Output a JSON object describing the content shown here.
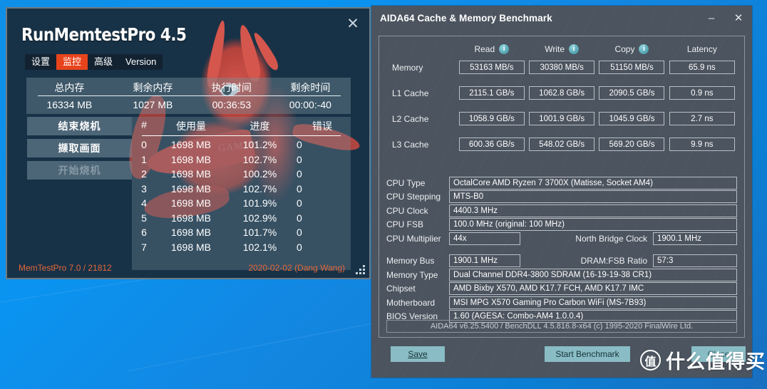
{
  "desktop": {
    "wallpaper_color": "#0a8fe8"
  },
  "memtest_window": {
    "title": "RunMemtestPro 4.5",
    "close_label": "✕",
    "tabs": [
      {
        "label": "设置",
        "active": false
      },
      {
        "label": "监控",
        "active": true
      },
      {
        "label": "高级",
        "active": false
      },
      {
        "label": "Version",
        "active": false
      }
    ],
    "active_tab_color": "#e8441c",
    "stats": {
      "headers": [
        "总内存",
        "剩余内存",
        "执行时间",
        "剩余时间"
      ],
      "values": [
        "16334 MB",
        "1027 MB",
        "00:36:53",
        "00:00:-40"
      ]
    },
    "buttons": [
      {
        "label": "结束烧机",
        "disabled": false
      },
      {
        "label": "撷取画面",
        "disabled": false
      },
      {
        "label": "开始烧机",
        "disabled": true
      }
    ],
    "table": {
      "headers": [
        "#",
        "使用量",
        "进度",
        "错误"
      ],
      "rows": [
        {
          "index": "0",
          "usage": "1698 MB",
          "progress": "101.2%",
          "errors": "0"
        },
        {
          "index": "1",
          "usage": "1698 MB",
          "progress": "102.7%",
          "errors": "0"
        },
        {
          "index": "2",
          "usage": "1698 MB",
          "progress": "100.2%",
          "errors": "0"
        },
        {
          "index": "3",
          "usage": "1698 MB",
          "progress": "102.7%",
          "errors": "0"
        },
        {
          "index": "4",
          "usage": "1698 MB",
          "progress": "101.9%",
          "errors": "0"
        },
        {
          "index": "5",
          "usage": "1698 MB",
          "progress": "102.9%",
          "errors": "0"
        },
        {
          "index": "6",
          "usage": "1698 MB",
          "progress": "101.7%",
          "errors": "0"
        },
        {
          "index": "7",
          "usage": "1698 MB",
          "progress": "102.1%",
          "errors": "0"
        }
      ]
    },
    "footer_left": "MemTestPro 7.0 / 21812",
    "footer_right": "2020-02-02 (Dang Wang)",
    "footer_color": "#e4663a",
    "background_watermark": "GAMING"
  },
  "aida_window": {
    "title": "AIDA64 Cache & Memory Benchmark",
    "minimize_label": "–",
    "close_label": "✕",
    "benchmark": {
      "columns": [
        "Read",
        "Write",
        "Copy",
        "Latency"
      ],
      "column_has_info_icon": [
        true,
        true,
        true,
        false
      ],
      "rows": [
        {
          "label": "Memory",
          "read": "53163 MB/s",
          "write": "30380 MB/s",
          "copy": "51150 MB/s",
          "latency": "65.9 ns"
        },
        {
          "label": "L1 Cache",
          "read": "2115.1 GB/s",
          "write": "1062.8 GB/s",
          "copy": "2090.5 GB/s",
          "latency": "0.9 ns"
        },
        {
          "label": "L2 Cache",
          "read": "1058.9 GB/s",
          "write": "1001.9 GB/s",
          "copy": "1045.9 GB/s",
          "latency": "2.7 ns"
        },
        {
          "label": "L3 Cache",
          "read": "600.36 GB/s",
          "write": "548.02 GB/s",
          "copy": "569.20 GB/s",
          "latency": "9.9 ns"
        }
      ]
    },
    "system": {
      "cpu_type_label": "CPU Type",
      "cpu_type_value": "OctalCore AMD Ryzen 7 3700X  (Matisse, Socket AM4)",
      "cpu_stepping_label": "CPU Stepping",
      "cpu_stepping_value": "MTS-B0",
      "cpu_clock_label": "CPU Clock",
      "cpu_clock_value": "4400.3 MHz",
      "cpu_fsb_label": "CPU FSB",
      "cpu_fsb_value": "100.0 MHz  (original: 100 MHz)",
      "cpu_multiplier_label": "CPU Multiplier",
      "cpu_multiplier_value": "44x",
      "north_bridge_label": "North Bridge Clock",
      "north_bridge_value": "1900.1 MHz",
      "memory_bus_label": "Memory Bus",
      "memory_bus_value": "1900.1 MHz",
      "dram_fsb_label": "DRAM:FSB Ratio",
      "dram_fsb_value": "57:3",
      "memory_type_label": "Memory Type",
      "memory_type_value": "Dual Channel DDR4-3800 SDRAM  (16-19-19-38 CR1)",
      "chipset_label": "Chipset",
      "chipset_value": "AMD Bixby X570, AMD K17.7 FCH, AMD K17.7 IMC",
      "motherboard_label": "Motherboard",
      "motherboard_value": "MSI MPG X570 Gaming Pro Carbon WiFi (MS-7B93)",
      "bios_label": "BIOS Version",
      "bios_value": "1.60  (AGESA: Combo-AM4 1.0.0.4)"
    },
    "version_line": "AIDA64 v6.25.5400 / BenchDLL 4.5.816.8-x64  (c) 1995-2020 FinalWire Ltd.",
    "buttons": {
      "save": "Save",
      "start_benchmark": "Start Benchmark",
      "close": "Close"
    },
    "button_color": "#89bcc4"
  },
  "watermark": {
    "logo_char": "值",
    "text": "什么值得买"
  }
}
